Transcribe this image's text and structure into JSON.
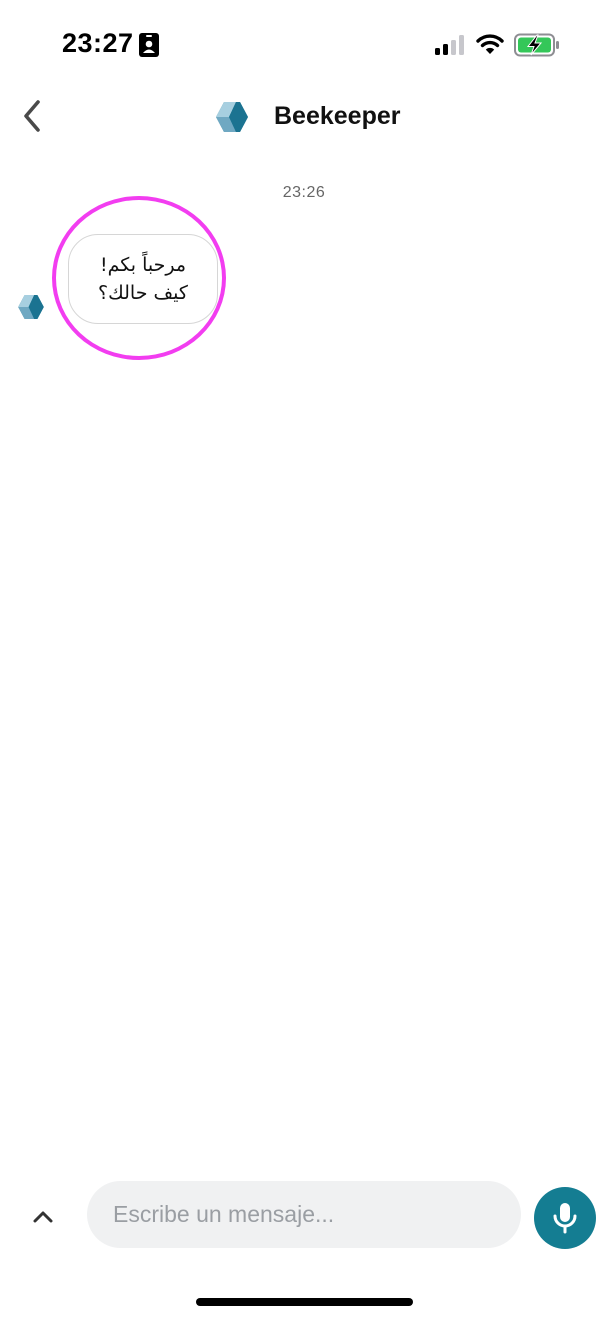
{
  "status_bar": {
    "time": "23:27",
    "icons": [
      "id-card-icon",
      "signal-icon",
      "wifi-icon",
      "battery-charging-icon"
    ]
  },
  "header": {
    "back_icon": "chevron-left-icon",
    "logo_icon": "beekeeper-logo-icon",
    "title": "Beekeeper"
  },
  "chat": {
    "timestamp": "23:26",
    "messages": [
      {
        "sender_icon": "beekeeper-logo-icon",
        "lines": [
          "مرحباً بكم!",
          "كيف حالك؟"
        ]
      }
    ]
  },
  "composer": {
    "expand_icon": "chevron-up-icon",
    "placeholder": "Escribe un mensaje...",
    "value": "",
    "mic_icon": "microphone-icon"
  },
  "colors": {
    "accent": "#147d92",
    "highlight": "#f23df0",
    "input_bg": "#f0f1f2"
  }
}
